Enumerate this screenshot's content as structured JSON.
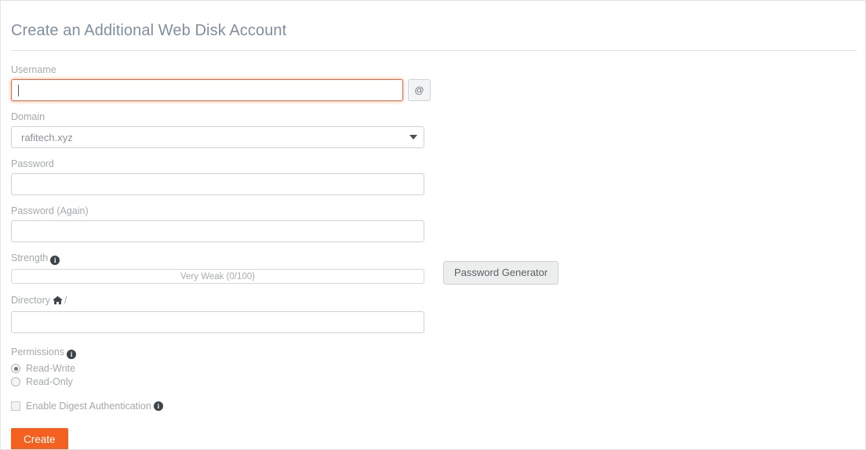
{
  "page": {
    "title": "Create an Additional Web Disk Account"
  },
  "form": {
    "username": {
      "label": "Username",
      "value": "",
      "placeholder": "",
      "addon": "@"
    },
    "domain": {
      "label": "Domain",
      "selected": "rafitech.xyz",
      "options": [
        "rafitech.xyz"
      ],
      "arrow_icon": "chevron-down-icon"
    },
    "password": {
      "label": "Password",
      "value": "",
      "placeholder": ""
    },
    "password_again": {
      "label": "Password (Again)",
      "value": "",
      "placeholder": ""
    },
    "strength": {
      "label": "Strength",
      "info_icon": "info-icon",
      "meter_text": "Very Weak (0/100)",
      "score": 0,
      "max": 100,
      "generator_button": "Password Generator"
    },
    "directory": {
      "label": "Directory",
      "home_icon": "home-icon",
      "separator": "/",
      "value": "",
      "placeholder": ""
    },
    "permissions": {
      "label": "Permissions",
      "info_icon": "info-icon",
      "options": [
        {
          "label": "Read-Write",
          "checked": true
        },
        {
          "label": "Read-Only",
          "checked": false
        }
      ]
    },
    "digest_auth": {
      "label": "Enable Digest Authentication",
      "checked": false,
      "info_icon": "info-icon"
    },
    "submit": {
      "label": "Create"
    }
  },
  "colors": {
    "accent": "#f4601f",
    "focus_border": "#f3663a",
    "title": "#7f8fa0",
    "label": "#a3a9ad",
    "border": "#cfd3d6"
  }
}
